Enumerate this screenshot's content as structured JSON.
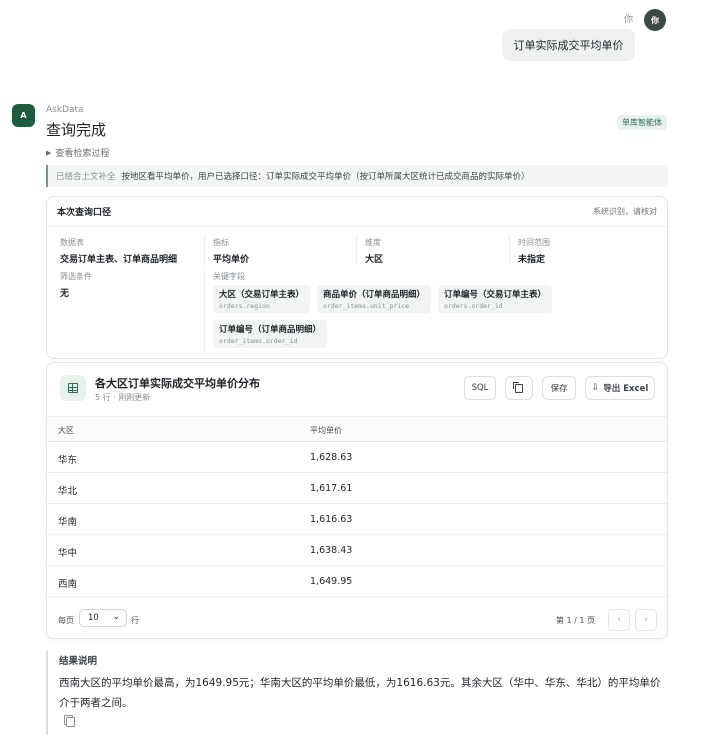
{
  "user": {
    "name": "你",
    "avatar_text": "你",
    "message": "订单实际成交平均单价"
  },
  "assistant": {
    "avatar_text": "A",
    "name": "AskData",
    "status_title": "查询完成",
    "badge": "单库智能体",
    "trace_toggle": "查看检索过程",
    "context_tag": "已结合上文补全",
    "context_text": "按地区看平均单价，用户已选择口径：订单实际成交平均单价（按订单所属大区统计已成交商品的实际单价）"
  },
  "scope": {
    "title": "本次查询口径",
    "note": "系统识别，请核对",
    "cells": [
      {
        "label": "数据表",
        "value": "交易订单主表、订单商品明细"
      },
      {
        "label": "指标",
        "value": "平均单价"
      },
      {
        "label": "维度",
        "value": "大区"
      },
      {
        "label": "时间范围",
        "value": "未指定"
      },
      {
        "label": "筛选条件",
        "value": "无"
      }
    ],
    "key_fields_label": "关键字段",
    "key_fields": [
      {
        "name": "大区（交易订单主表）",
        "code": "orders.region"
      },
      {
        "name": "商品单价（订单商品明细）",
        "code": "order_items.unit_price"
      },
      {
        "name": "订单编号（交易订单主表）",
        "code": "orders.order_id"
      },
      {
        "name": "订单编号（订单商品明细）",
        "code": "order_items.order_id"
      }
    ]
  },
  "result": {
    "title": "各大区订单实际成交平均单价分布",
    "subtitle": "5 行 · 刚刚更新",
    "buttons": {
      "sql": "SQL",
      "copy_icon": "copy-icon",
      "save": "保存",
      "export": "导出 Excel",
      "export_icon": "download-icon"
    },
    "columns": [
      "大区",
      "平均单价"
    ],
    "rows": [
      [
        "华东",
        "1,628.63"
      ],
      [
        "华北",
        "1,617.61"
      ],
      [
        "华南",
        "1,616.63"
      ],
      [
        "华中",
        "1,638.43"
      ],
      [
        "西南",
        "1,649.95"
      ]
    ],
    "pager": {
      "per_page_label": "每页",
      "per_page_value": "10",
      "rows_label": "行",
      "page_info": "第 1 / 1 页",
      "prev": "‹",
      "next": "›"
    }
  },
  "explanation": {
    "title": "结果说明",
    "text": "西南大区的平均单价最高，为1649.95元；华南大区的平均单价最低，为1616.63元。其余大区（华中、华东、华北）的平均单价介于两者之间。"
  },
  "colors": {
    "brand_green": "#1f5c3d",
    "accent_green": "#2f6f4e",
    "badge_bg": "#e8f1ec"
  }
}
